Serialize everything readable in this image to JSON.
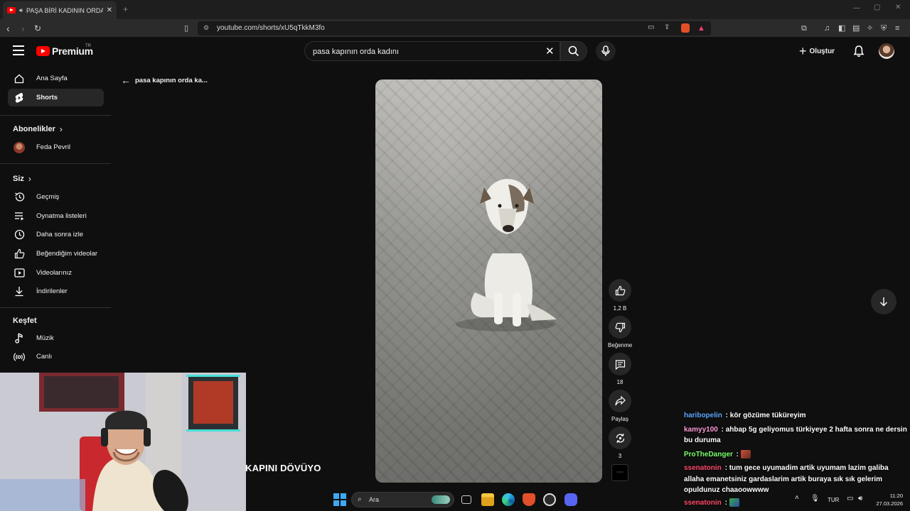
{
  "browser": {
    "tab_title": "PAŞA BİRİ KADININ ORDA KA",
    "url": "youtube.com/shorts/xU5qTkkM3fo"
  },
  "header": {
    "logo_text": "Premium",
    "logo_region": "TR",
    "search_query": "pasa kapının orda kadını",
    "create_label": "Oluştur"
  },
  "sidebar": {
    "top_items": [
      {
        "label": "Ana Sayfa",
        "icon": "home-icon"
      },
      {
        "label": "Shorts",
        "icon": "shorts-icon"
      }
    ],
    "subscriptions_heading": "Abonelikler",
    "subscriptions": [
      {
        "label": "Feda Pevril"
      }
    ],
    "you_heading": "Siz",
    "you_items": [
      {
        "label": "Geçmiş",
        "icon": "history-icon"
      },
      {
        "label": "Oynatma listeleri",
        "icon": "playlist-icon"
      },
      {
        "label": "Daha sonra izle",
        "icon": "clock-icon"
      },
      {
        "label": "Beğendiğim videolar",
        "icon": "thumbs-up-icon"
      },
      {
        "label": "Videolarınız",
        "icon": "video-icon"
      },
      {
        "label": "İndirilenler",
        "icon": "download-icon"
      }
    ],
    "explore_heading": "Keşfet",
    "explore_items": [
      {
        "label": "Müzik",
        "icon": "music-icon"
      },
      {
        "label": "Canlı",
        "icon": "live-icon"
      }
    ]
  },
  "back": {
    "label": "pasa kapının orda ka..."
  },
  "actions": {
    "like_count": "1,2 B",
    "dislike_label": "Beğenme",
    "comment_count": "18",
    "share_label": "Paylaş",
    "remix_count": "3"
  },
  "stream_caption": "KAPINI DÖVÜYO",
  "chat": [
    {
      "user": "haribopelin",
      "user_color": "#5fa8ff",
      "text": "kör gözüme tüküreyim"
    },
    {
      "user": "kamyy100",
      "user_color": "#ff9ad5",
      "text": "ahbap 5g geliyomus türkiyeye 2 hafta sonra ne dersin bu duruma"
    },
    {
      "user": "ProTheDanger",
      "user_color": "#7cff6a",
      "text": ""
    },
    {
      "user": "ssenatonin",
      "user_color": "#ff4a6a",
      "text": "tum gece uyumadim artik uyumam lazim galiba allaha emanetsiniz gardaslarim artik buraya sık sık gelerim opuldunuz chaaoowwww"
    },
    {
      "user": "ssenatonin",
      "user_color": "#ff4a6a",
      "text": ""
    }
  ],
  "taskbar": {
    "search_placeholder": "Ara",
    "language": "TUR",
    "time": "11:20",
    "date": "27.03.2026"
  },
  "colors": {
    "background": "#0f0f0f",
    "youtube_red": "#ff0000",
    "surface": "#272727"
  }
}
